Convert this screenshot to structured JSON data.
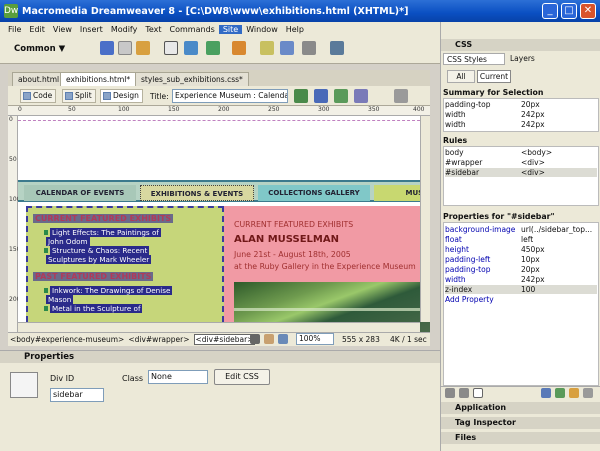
{
  "window": {
    "title": "Macromedia Dreamweaver 8 - [C:\\DW8\\www\\exhibitions.html (XHTML)*]",
    "min": "_",
    "max": "□",
    "close": "✕"
  },
  "menu": [
    "File",
    "Edit",
    "View",
    "Insert",
    "Modify",
    "Text",
    "Commands",
    "Site",
    "Window",
    "Help"
  ],
  "menu_selected": "Site",
  "insert_bar": {
    "category": "Common ▼"
  },
  "doc_tabs": [
    "about.html",
    "exhibitions.html*",
    "styles_sub_exhibitions.css*"
  ],
  "doc_toolbar": {
    "code": "Code",
    "split": "Split",
    "design": "Design",
    "title_label": "Title:",
    "title_value": "Experience Museum : Calenda"
  },
  "ruler": {
    "top_ticks": [
      "0",
      "50",
      "100",
      "150",
      "200",
      "250",
      "300",
      "350",
      "400"
    ],
    "left_ticks": [
      "0",
      "50",
      "100",
      "150",
      "200"
    ]
  },
  "page": {
    "nav": [
      "CALENDAR OF EVENTS",
      "EXHIBITIONS & EVENTS",
      "COLLECTIONS GALLERY",
      "MUSE"
    ],
    "sidebar": {
      "heading1": "CURRENT FEATURED EXHIBITS",
      "item1_l1": "Light Effects: The Paintings of",
      "item1_l2": "John Odom",
      "item2_l1": "Structure & Chaos: Recent",
      "item2_l2": "Sculptures by Mark Wheeler",
      "heading2": "PAST FEATURED EXHIBITS",
      "item3_l1": "Inkwork: The Drawings of Denise",
      "item3_l2": "Mason",
      "item4_l1": "Metal in the Sculpture of"
    },
    "main": {
      "heading": "CURRENT FEATURED EXHIBITS",
      "artist": "ALAN MUSSELMAN",
      "dates": "June 21st - August 18th, 2005",
      "venue": "at the Ruby Gallery in the Experience Museum"
    }
  },
  "status": {
    "tags": [
      "<body#experience-museum>",
      "<div#wrapper>",
      "<div#sidebar>"
    ],
    "zoom": "100%",
    "size": "555 x 283",
    "weight": "4K / 1 sec"
  },
  "properties": {
    "title": "Properties",
    "divid_label": "Div ID",
    "divid_value": "sidebar",
    "class_label": "Class",
    "class_value": "None",
    "edit_css": "Edit CSS"
  },
  "css_panel": {
    "title": "CSS",
    "tabs": [
      "CSS Styles",
      "Layers"
    ],
    "mode": [
      "All",
      "Current"
    ],
    "summary_title": "Summary for Selection",
    "summary": [
      {
        "k": "padding-top",
        "v": "20px"
      },
      {
        "k": "width",
        "v": "242px"
      },
      {
        "k": "width",
        "v": "242px"
      }
    ],
    "rules_title": "Rules",
    "rules": [
      {
        "k": "body",
        "v": "<body>"
      },
      {
        "k": "#wrapper",
        "v": "<div>"
      },
      {
        "k": "#sidebar",
        "v": "<div>"
      }
    ],
    "props_title": "Properties for \"#sidebar\"",
    "props": [
      {
        "k": "background-image",
        "v": "url(../sidebar_top..."
      },
      {
        "k": "float",
        "v": "left"
      },
      {
        "k": "height",
        "v": "450px"
      },
      {
        "k": "padding-left",
        "v": "10px"
      },
      {
        "k": "padding-top",
        "v": "20px"
      },
      {
        "k": "width",
        "v": "242px"
      },
      {
        "k": "z-index",
        "v": "100"
      }
    ],
    "add_property": "Add Property",
    "panels": [
      "Application",
      "Tag Inspector",
      "Files"
    ]
  }
}
